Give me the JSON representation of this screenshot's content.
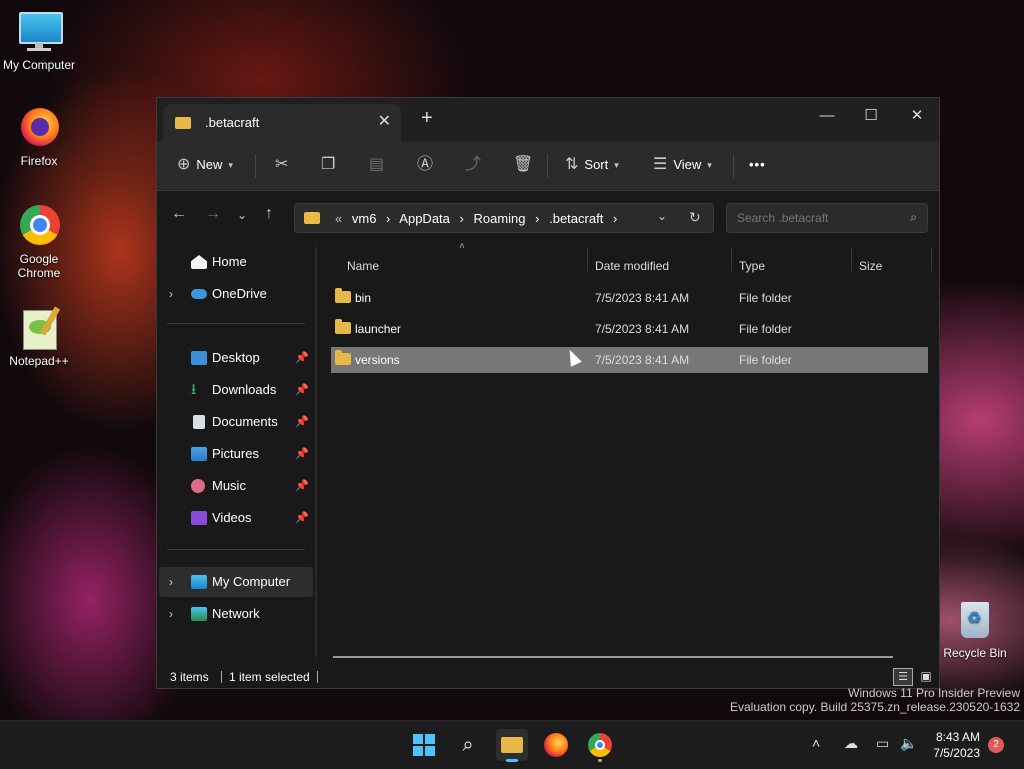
{
  "desktop": {
    "icons": [
      {
        "label": "My Computer"
      },
      {
        "label": "Firefox"
      },
      {
        "label": "Google Chrome"
      },
      {
        "label": "Notepad++"
      },
      {
        "label": "Recycle Bin"
      }
    ]
  },
  "window": {
    "tab_title": ".betacraft",
    "new_tab": "+",
    "controls": {
      "minimize": "—",
      "maximize": "☐",
      "close": "✕"
    },
    "toolbar": {
      "new_label": "New",
      "sort_label": "Sort",
      "view_label": "View",
      "more_label": "•••"
    },
    "address": {
      "overflow": "«",
      "crumbs": [
        "vm6",
        "AppData",
        "Roaming",
        ".betacraft"
      ],
      "separator": "›"
    },
    "search": {
      "placeholder": "Search .betacraft"
    },
    "sidebar": {
      "home": "Home",
      "onedrive": "OneDrive",
      "quick": [
        "Desktop",
        "Downloads",
        "Documents",
        "Pictures",
        "Music",
        "Videos"
      ],
      "my_computer": "My Computer",
      "network": "Network"
    },
    "columns": {
      "name": "Name",
      "date": "Date modified",
      "type": "Type",
      "size": "Size"
    },
    "files": [
      {
        "name": "bin",
        "date": "7/5/2023 8:41 AM",
        "type": "File folder",
        "size": ""
      },
      {
        "name": "launcher",
        "date": "7/5/2023 8:41 AM",
        "type": "File folder",
        "size": ""
      },
      {
        "name": "versions",
        "date": "7/5/2023 8:41 AM",
        "type": "File folder",
        "size": ""
      }
    ],
    "status": {
      "items": "3 items",
      "selected": "1 item selected"
    }
  },
  "watermark": {
    "line1": "Windows 11 Pro Insider Preview",
    "line2": "Evaluation copy. Build 25375.zn_release.230520-1632"
  },
  "taskbar": {
    "time": "8:43 AM",
    "date": "7/5/2023",
    "notifications": "2"
  },
  "colors": {
    "accent": "#0078d4",
    "folder": "#e8b84a",
    "selection": "#777777"
  }
}
